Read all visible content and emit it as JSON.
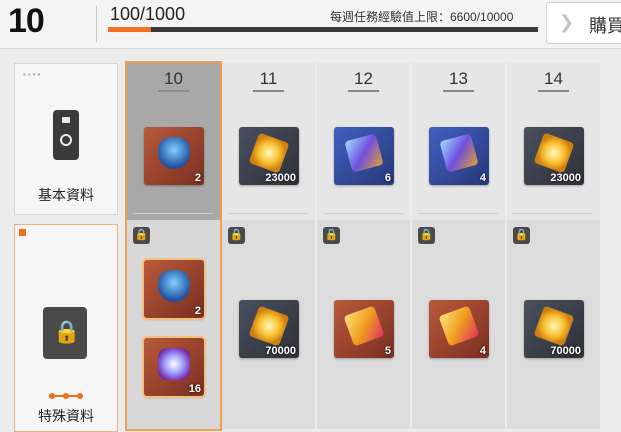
{
  "header": {
    "level": "10",
    "xp_text": "100/1000",
    "xp_progress": 0.1,
    "weekly_cap": "每週任務經驗值上限：6600/10000",
    "buy_label": "購買"
  },
  "sidebar": {
    "cards": [
      {
        "label": "基本資料",
        "icon": "device-icon"
      },
      {
        "label": "特殊資料",
        "icon": "locked-file-icon"
      }
    ]
  },
  "columns": [
    {
      "level": "10",
      "selected": true,
      "free": {
        "qty": "2",
        "icon": "shield-badge-icon",
        "bg": "red"
      },
      "premium": [
        {
          "qty": "2",
          "icon": "shield-orb-icon",
          "bg": "red"
        },
        {
          "qty": "16",
          "icon": "crystal-gem-icon",
          "bg": "red"
        }
      ]
    },
    {
      "level": "11",
      "free": {
        "qty": "23000",
        "icon": "gold-chip-icon",
        "bg": "dark"
      },
      "premium": [
        {
          "qty": "70000",
          "icon": "gold-chip-icon",
          "bg": "dark"
        }
      ]
    },
    {
      "level": "12",
      "free": {
        "qty": "6",
        "icon": "holo-ticket-icon",
        "bg": "blue"
      },
      "premium": [
        {
          "qty": "5",
          "icon": "gold-ticket-icon",
          "bg": "red"
        }
      ]
    },
    {
      "level": "13",
      "free": {
        "qty": "4",
        "icon": "holo-ticket-icon",
        "bg": "blue"
      },
      "premium": [
        {
          "qty": "4",
          "icon": "gold-ticket-icon",
          "bg": "red"
        }
      ]
    },
    {
      "level": "14",
      "free": {
        "qty": "23000",
        "icon": "gold-chip-icon",
        "bg": "dark"
      },
      "premium": [
        {
          "qty": "70000",
          "icon": "gold-chip-icon",
          "bg": "dark"
        }
      ]
    }
  ]
}
